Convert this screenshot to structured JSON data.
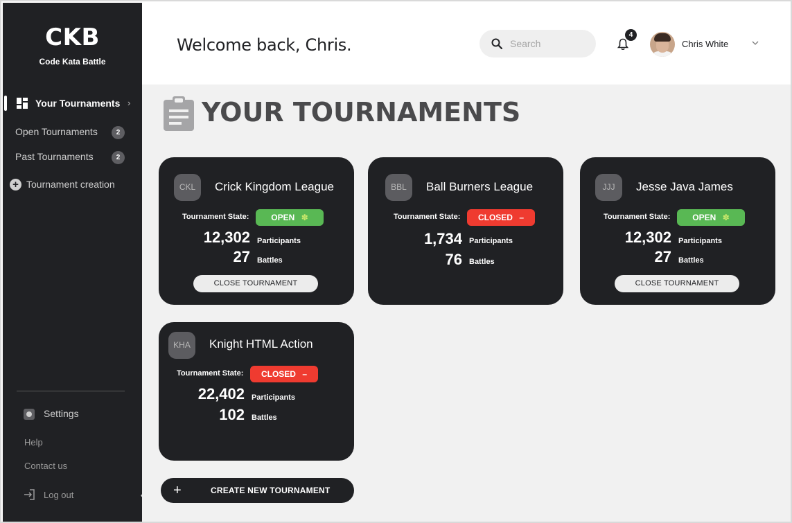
{
  "app": {
    "logo": "CKB",
    "logo_subtitle": "Code Kata Battle"
  },
  "sidebar": {
    "active_item": {
      "label": "Your Tournaments",
      "icon": "dashboard-icon"
    },
    "items": [
      {
        "label": "Open Tournaments",
        "count": "2"
      },
      {
        "label": "Past Tournaments",
        "count": "2"
      }
    ],
    "create_item": {
      "label": "Tournament creation",
      "icon": "plus-circle-icon"
    },
    "settings_label": "Settings",
    "help_label": "Help",
    "contact_label": "Contact us",
    "logout_label": "Log out",
    "collapse_glyph": "‹"
  },
  "header": {
    "welcome": "Welcome back, Chris.",
    "search_placeholder": "Search",
    "notification_count": "4",
    "user_name": "Chris White"
  },
  "main": {
    "title": "YOUR TOURNAMENTS",
    "state_label": "Tournament State:",
    "participants_label": "Participants",
    "battles_label": "Battles",
    "close_button_label": "CLOSE TOURNAMENT",
    "create_button_label": "CREATE NEW TOURNAMENT",
    "create_button_glyph": "+",
    "cards": [
      {
        "initials": "CKL",
        "name": "Crick Kingdom League",
        "state": "OPEN",
        "state_glyph": "✽",
        "participants": "12,302",
        "battles": "27",
        "has_close_button": true
      },
      {
        "initials": "BBL",
        "name": "Ball Burners League",
        "state": "CLOSED",
        "state_glyph": "–",
        "participants": "1,734",
        "battles": "76",
        "has_close_button": false
      },
      {
        "initials": "JJJ",
        "name": "Jesse Java James",
        "state": "OPEN",
        "state_glyph": "✽",
        "participants": "12,302",
        "battles": "27",
        "has_close_button": true
      },
      {
        "initials": "KHA",
        "name": "Knight HTML Action",
        "state": "CLOSED",
        "state_glyph": "–",
        "participants": "22,402",
        "battles": "102",
        "has_close_button": false
      }
    ]
  },
  "colors": {
    "sidebar_bg": "#202124",
    "main_bg": "#f1f1f1",
    "open": "#59b854",
    "closed": "#ef3b30",
    "title": "#4a4a4c"
  }
}
